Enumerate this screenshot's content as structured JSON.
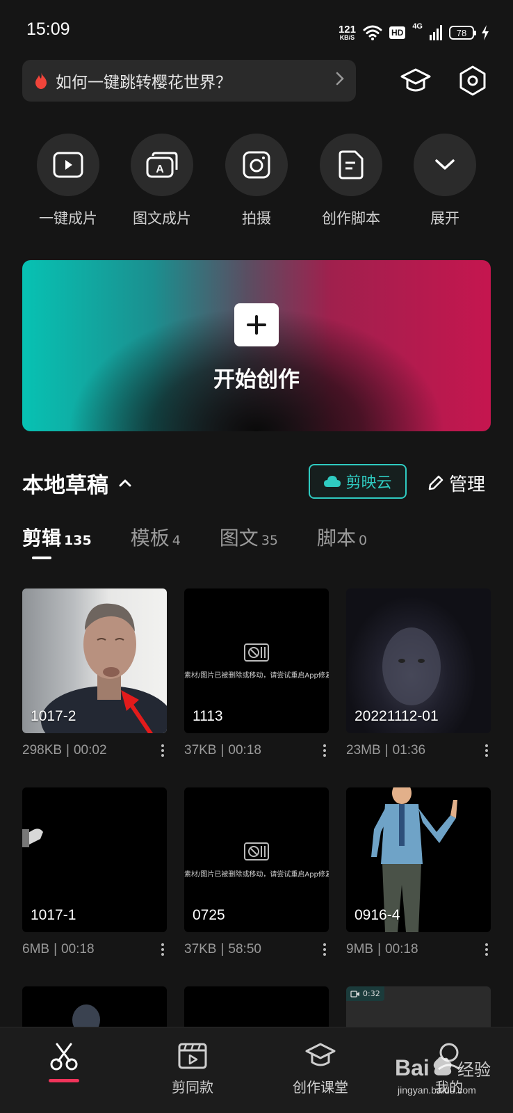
{
  "status_bar": {
    "time": "15:09",
    "net_speed": "121",
    "net_unit": "KB/S",
    "hd": "HD",
    "network": "4G",
    "battery": "78"
  },
  "search": {
    "text": "如何一键跳转樱花世界？"
  },
  "shortcuts": [
    {
      "label": "一键成片",
      "icon": "play-icon"
    },
    {
      "label": "图文成片",
      "icon": "text-to-video-icon"
    },
    {
      "label": "拍摄",
      "icon": "camera-icon"
    },
    {
      "label": "创作脚本",
      "icon": "script-icon"
    },
    {
      "label": "展开",
      "icon": "chevron-down-icon"
    }
  ],
  "banner": {
    "title": "开始创作"
  },
  "drafts": {
    "title": "本地草稿",
    "cloud_label": "剪映云",
    "manage_label": "管理"
  },
  "tabs": [
    {
      "name": "剪辑",
      "count": "135",
      "active": true
    },
    {
      "name": "模板",
      "count": "4",
      "active": false
    },
    {
      "name": "图文",
      "count": "35",
      "active": false
    },
    {
      "name": "脚本",
      "count": "0",
      "active": false
    }
  ],
  "missing_text": "素材/图片已被删除或移动，请尝试重启App修复",
  "drafts_grid": [
    {
      "name": "1017-2",
      "size": "298KB",
      "duration": "00:02"
    },
    {
      "name": "1113",
      "size": "37KB",
      "duration": "00:18"
    },
    {
      "name": "20221112-01",
      "size": "23MB",
      "duration": "01:36"
    },
    {
      "name": "1017-1",
      "size": "6MB",
      "duration": "00:18"
    },
    {
      "name": "0725",
      "size": "37KB",
      "duration": "58:50"
    },
    {
      "name": "0916-4",
      "size": "9MB",
      "duration": "00:18"
    }
  ],
  "partial_badge": "0:32",
  "bottom_nav": [
    {
      "label": "",
      "icon": "scissors-icon",
      "active": true
    },
    {
      "label": "剪同款",
      "icon": "template-icon",
      "active": false
    },
    {
      "label": "创作课堂",
      "icon": "graduation-cap-icon",
      "active": false
    },
    {
      "label": "我的",
      "icon": "profile-icon",
      "active": false
    }
  ],
  "watermark": {
    "brand": "Bai",
    "suffix": "经验",
    "url": "jingyan.baidu.com"
  },
  "colors": {
    "background": "#151515",
    "accent_cyan": "#2fcbc1",
    "accent_red": "#f0345a"
  }
}
